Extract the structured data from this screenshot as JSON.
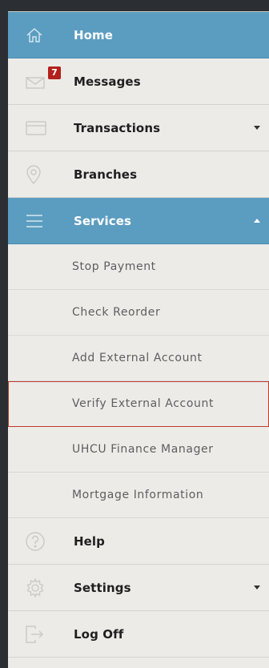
{
  "menu": {
    "home": "Home",
    "messages": "Messages",
    "messages_badge": "7",
    "transactions": "Transactions",
    "branches": "Branches",
    "services": "Services",
    "services_sub": [
      "Stop Payment",
      "Check Reorder",
      "Add External Account",
      "Verify External Account",
      "UHCU Finance Manager",
      "Mortgage Information"
    ],
    "help": "Help",
    "settings": "Settings",
    "logoff": "Log Off"
  },
  "icons": {
    "home": "home-icon",
    "messages": "envelope-icon",
    "transactions": "card-icon",
    "branches": "location-pin-icon",
    "services": "menu-lines-icon",
    "help": "question-icon",
    "settings": "gear-icon",
    "logoff": "logout-icon"
  },
  "colors": {
    "active": "#5b9dc0",
    "badge": "#b3201b",
    "highlight_border": "#c0392b"
  }
}
